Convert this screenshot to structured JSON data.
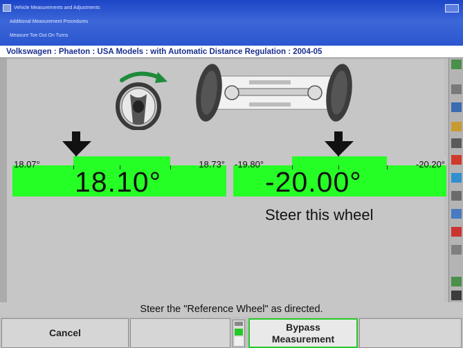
{
  "titlebar": {
    "line1": "Vehicle Measurements and Adjustments",
    "line2": "Additional Measurement Procedures",
    "line3": "Measure Toe Out On Turns"
  },
  "vehicle": {
    "description": "Volkswagen : Phaeton : USA Models : with Automatic Distance Regulation : 2004-05"
  },
  "left_gauge": {
    "min_label": "18.07°",
    "max_label": "18.73°",
    "reading": "18.10°"
  },
  "right_gauge": {
    "min_label": "-19.80°",
    "max_label": "-20.20°",
    "reading": "-20.00°",
    "caption": "Steer this wheel"
  },
  "instruction": "Steer the \"Reference Wheel\" as directed.",
  "buttons": {
    "cancel": "Cancel",
    "bypass_line1": "Bypass",
    "bypass_line2": "Measurement"
  },
  "colors": {
    "gauge_green": "#26ff26",
    "title_blue": "#2b55cf",
    "steer_arrow_green": "#1e8a3a"
  },
  "icons": [
    "steering-wheel-icon",
    "axle-icon",
    "down-arrow-icon",
    "toolbar-icon"
  ]
}
